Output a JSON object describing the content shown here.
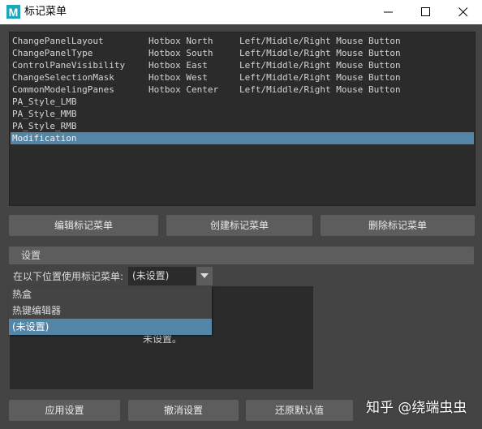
{
  "window": {
    "title": "标记菜单",
    "app_icon_letter": "M",
    "controls": [
      "minimize-icon",
      "maximize-icon",
      "close-icon"
    ]
  },
  "list": {
    "rows": [
      {
        "name": "ChangePanelLayout",
        "hotbox": "Hotbox North",
        "mouse": "Left/Middle/Right Mouse Button"
      },
      {
        "name": "ChangePanelType",
        "hotbox": "Hotbox South",
        "mouse": "Left/Middle/Right Mouse Button"
      },
      {
        "name": "ControlPaneVisibility",
        "hotbox": "Hotbox East",
        "mouse": "Left/Middle/Right Mouse Button"
      },
      {
        "name": "ChangeSelectionMask",
        "hotbox": "Hotbox West",
        "mouse": "Left/Middle/Right Mouse Button"
      },
      {
        "name": "CommonModelingPanes",
        "hotbox": "Hotbox Center",
        "mouse": "Left/Middle/Right Mouse Button"
      },
      {
        "name": "PA_Style_LMB",
        "hotbox": "",
        "mouse": ""
      },
      {
        "name": "PA_Style_MMB",
        "hotbox": "",
        "mouse": ""
      },
      {
        "name": "PA_Style_RMB",
        "hotbox": "",
        "mouse": ""
      },
      {
        "name": "Modification",
        "hotbox": "",
        "mouse": ""
      }
    ],
    "selected_index": 8
  },
  "actions": {
    "edit": "编辑标记菜单",
    "create": "创建标记菜单",
    "delete": "删除标记菜单"
  },
  "settings": {
    "header": "设置",
    "use_label": "在以下位置使用标记菜单:",
    "combo_value": "(未设置)",
    "dropdown_options": [
      "热盒",
      "热键编辑器",
      "(未设置)"
    ],
    "dropdown_selected_index": 2,
    "panel_text": "未设置。"
  },
  "footer": {
    "apply": "应用设置",
    "undo": "撤消设置",
    "restore": "还原默认值"
  },
  "watermark": "知乎 @绕端虫虫",
  "colors": {
    "background": "#444444",
    "list_background": "#2b2b2b",
    "selection": "#5285a6",
    "button": "#5d5d5d"
  }
}
